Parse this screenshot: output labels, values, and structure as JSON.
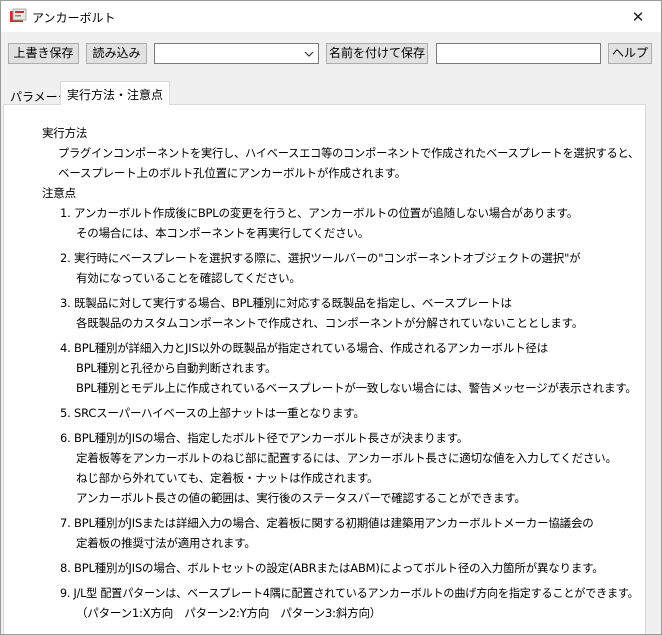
{
  "window": {
    "title": "アンカーボルト",
    "close_glyph": "✕"
  },
  "toolbar": {
    "save_overwrite": "上書き保存",
    "load": "読み込み",
    "preset_select_value": "",
    "save_as": "名前を付けて保存",
    "save_as_name_value": "",
    "help": "ヘルプ"
  },
  "tabs": [
    {
      "label": "パラメータ",
      "active": false
    },
    {
      "label": "実行方法・注意点",
      "active": true
    }
  ],
  "instructions": {
    "lines": [
      "実行方法",
      "プラグインコンポーネントを実行し、ハイベースエコ等のコンポーネントで作成されたベースプレートを選択すると、",
      "ベースプレート上のボルト孔位置にアンカーボルトが作成されます。",
      "注意点",
      "1. アンカーボルト作成後にBPLの変更を行うと、アンカーボルトの位置が追随しない場合があります。",
      "その場合には、本コンポーネントを再実行してください。",
      "2. 実行時にベースプレートを選択する際に、選択ツールバーの\"コンポーネントオブジェクトの選択\"が",
      "有効になっていることを確認してください。",
      "3. 既製品に対して実行する場合、BPL種別に対応する既製品を指定し、ベースプレートは",
      "各既製品のカスタムコンポーネントで作成され、コンポーネントが分解されていないこととします。",
      "4. BPL種別が詳細入力とJIS以外の既製品が指定されている場合、作成されるアンカーボルト径は",
      "BPL種別と孔径から自動判断されます。",
      "BPL種別とモデル上に作成されているベースプレートが一致しない場合には、警告メッセージが表示されます。",
      "5. SRCスーパーハイベースの上部ナットは一重となります。",
      "6. BPL種別がJISの場合、指定したボルト径でアンカーボルト長さが決まります。",
      "定着板等をアンカーボルトのねじ部に配置するには、アンカーボルト長さに適切な値を入力してください。",
      "ねじ部から外れていても、定着板・ナットは作成されます。",
      "アンカーボルト長さの値の範囲は、実行後のステータスバーで確認することができます。",
      "7. BPL種別がJISまたは詳細入力の場合、定着板に関する初期値は建築用アンカーボルトメーカー協議会の",
      "定着板の推奨寸法が適用されます。",
      "8. BPL種別がJISの場合、ボルトセットの設定(ABRまたはABM)によってボルト径の入力箇所が異なります。",
      "9. J/L型 配置パターンは、ベースプレート4隅に配置されているアンカーボルトの曲げ方向を指定することができます。",
      "（パターン1:X方向　パターン2:Y方向　パターン3:斜方向）"
    ]
  }
}
